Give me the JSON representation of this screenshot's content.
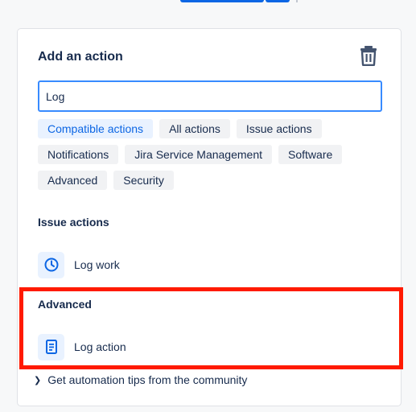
{
  "panel": {
    "title": "Add an action"
  },
  "search": {
    "value": "Log"
  },
  "filters": {
    "rows": [
      [
        {
          "label": "Compatible actions",
          "selected": true
        },
        {
          "label": "All actions",
          "selected": false
        },
        {
          "label": "Issue actions",
          "selected": false
        }
      ],
      [
        {
          "label": "Notifications",
          "selected": false
        },
        {
          "label": "Jira Service Management",
          "selected": false
        },
        {
          "label": "Software",
          "selected": false
        }
      ],
      [
        {
          "label": "Advanced",
          "selected": false
        },
        {
          "label": "Security",
          "selected": false
        }
      ]
    ]
  },
  "sections": [
    {
      "title": "Issue actions",
      "items": [
        {
          "label": "Log work",
          "icon": "clock-icon"
        }
      ]
    },
    {
      "title": "Advanced",
      "items": [
        {
          "label": "Log action",
          "icon": "document-icon"
        }
      ]
    }
  ],
  "footer": {
    "tips_label": "Get automation tips from the community"
  },
  "colors": {
    "accent": "#0c66e4",
    "highlight": "#ff1a00",
    "tag_bg": "#f1f2f4",
    "tag_selected_bg": "#e9f2ff"
  }
}
